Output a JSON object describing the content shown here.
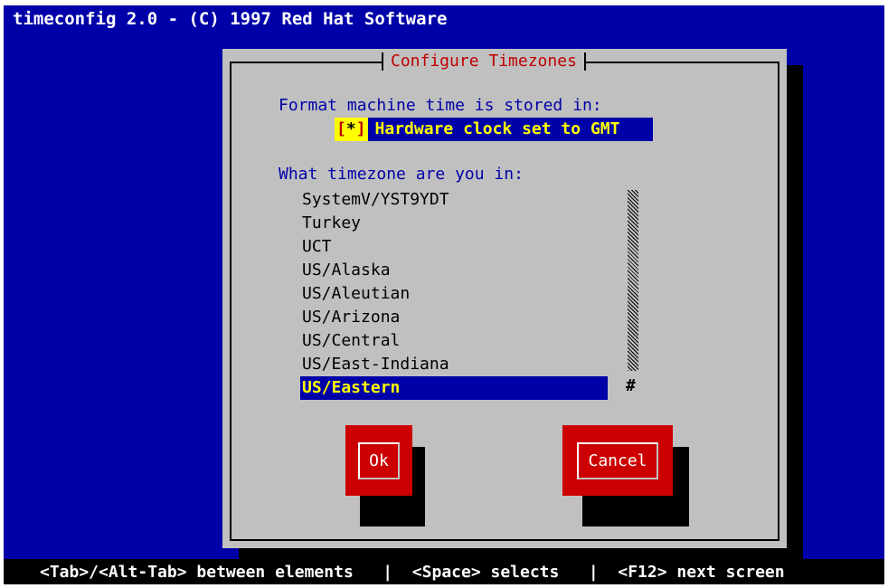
{
  "window": {
    "title": "timeconfig 2.0 - (C) 1997 Red Hat Software"
  },
  "dialog": {
    "title": "Configure Timezones",
    "format_label": "Format machine time is stored in:",
    "gmt_checkbox": {
      "checked_mark": "*",
      "label": "Hardware clock set to GMT",
      "checked": true
    },
    "timezone_label": "What timezone are you in:",
    "timezones": [
      "SystemV/YST9YDT",
      "Turkey",
      "UCT",
      "US/Alaska",
      "US/Aleutian",
      "US/Arizona",
      "US/Central",
      "US/East-Indiana",
      "US/Eastern"
    ],
    "selected_timezone": "US/Eastern",
    "scroll_thumb": "#",
    "buttons": {
      "ok": "Ok",
      "cancel": "Cancel"
    }
  },
  "status_bar": {
    "text": "<Tab>/<Alt-Tab> between elements   |  <Space> selects   |  <F12> next screen"
  },
  "colors": {
    "background": "#0000a8",
    "dialog": "#c0c0c0",
    "button": "#cc0000",
    "highlight_text": "#ffff00"
  }
}
